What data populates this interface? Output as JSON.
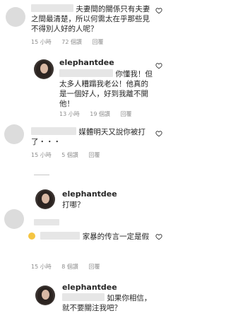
{
  "comments": [
    {
      "text": "夫妻間的關係只有夫妻之間最清楚，所以何需太在乎那些見不得別人好的人呢？",
      "time": "15 小時",
      "likes": "72 個讚",
      "reply": "回覆"
    },
    {
      "username": "elephantdee",
      "text": "你懂我！但太多人糟蹋我老公！他真的是一個好人，好到我離不開他！",
      "time": "13 小時",
      "likes": "19 個讚",
      "reply": "回覆"
    },
    {
      "text": "媒體明天又說你被打了・・・",
      "time": "15 小時",
      "likes": "5 個讚",
      "reply": "回覆"
    },
    {
      "username": "elephantdee",
      "text": "打哪？"
    },
    {
      "text": "家暴的传言一定是假",
      "time": "15 小時",
      "likes": "8 個讚",
      "reply": "回覆"
    },
    {
      "username": "elephantdee",
      "text": "如果你相信，就不要關注我吧？"
    }
  ],
  "divider": "",
  "colors": {
    "text": "#262626",
    "meta": "#8e8e8e",
    "placeholder": "#dcdcdc"
  },
  "icons": [
    "heart-icon",
    "avatar"
  ]
}
